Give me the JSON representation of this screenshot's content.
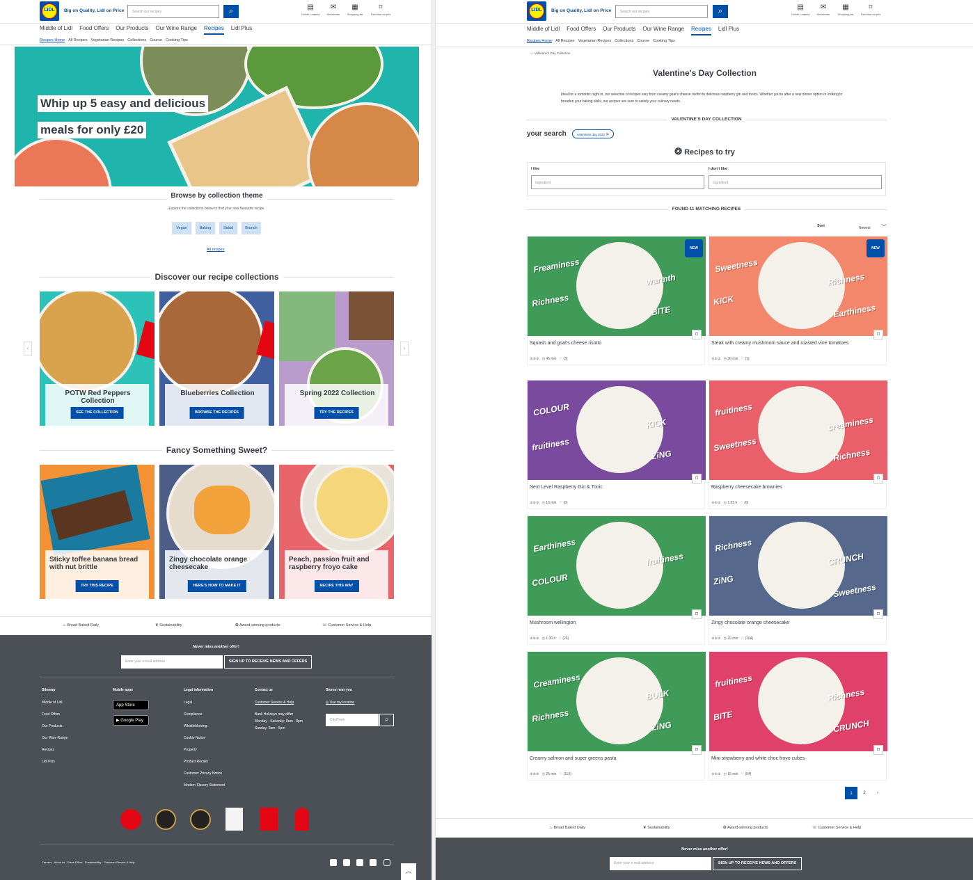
{
  "brand": {
    "logo": "LIDL",
    "tagline": "Big on Quality, Lidl on Price"
  },
  "header": {
    "search_placeholder": "Search our recipes",
    "icons": [
      {
        "label": "Online Leaflets",
        "icon": "leaflet-icon"
      },
      {
        "label": "Newsletter",
        "icon": "newsletter-icon"
      },
      {
        "label": "Shopping list",
        "icon": "shopping-list-icon"
      },
      {
        "label": "Favorite recipes",
        "icon": "bookmark-icon"
      }
    ]
  },
  "nav": {
    "main": [
      "Middle of Lidl",
      "Food Offers",
      "Our Products",
      "Our Wine Range",
      "Recipes",
      "Lidl Plus"
    ],
    "sub": [
      "Recipes Home",
      "All Recipes",
      "Vegetarian Recipes",
      "Collections",
      "Course",
      "Cooking Tips"
    ]
  },
  "left": {
    "hero": {
      "line1": "Whip up 5 easy and delicious",
      "line2": "meals for only £20"
    },
    "browse": {
      "title": "Browse by collection theme",
      "subtitle": "Explore the collections below to find your new favourite recipe.",
      "chips": [
        "Vegan",
        "Baking",
        "Salad",
        "Brunch"
      ],
      "all_link": "All recipes"
    },
    "discover": {
      "title": "Discover our recipe collections",
      "cards": [
        {
          "title": "POTW Red Peppers Collection",
          "button": "SEE THE COLLECTION"
        },
        {
          "title": "Blueberries Collection",
          "button": "BROWSE THE RECIPES"
        },
        {
          "title": "Spring 2022 Collection",
          "button": "TRY THE RECIPES"
        }
      ]
    },
    "sweet": {
      "title": "Fancy Something Sweet?",
      "cards": [
        {
          "title": "Sticky toffee banana bread with nut brittle",
          "button": "TRY THIS RECIPE"
        },
        {
          "title": "Zingy chocolate orange cheesecake",
          "button": "HERE'S HOW TO MAKE IT"
        },
        {
          "title": "Peach, passion fruit and raspberry froyo cake",
          "button": "RECIPE THIS WAY"
        }
      ]
    }
  },
  "features": [
    "Bread Baked Daily",
    "Sustainability",
    "Award-winning products",
    "Customer Service & Help"
  ],
  "footer": {
    "newsletter_title": "Never miss another offer!",
    "email_placeholder": "Enter your e-mail address",
    "signup_button": "SIGN UP TO RECEIVE NEWS AND OFFERS",
    "sitemap": {
      "heading": "Sitemap",
      "items": [
        "Middle of Lidl",
        "Food Offers",
        "Our Products",
        "Our Wine Range",
        "Recipes",
        "Lidl Plus"
      ]
    },
    "mobile": {
      "heading": "Mobile apps",
      "app_store": "App Store",
      "google_play": "Google Play"
    },
    "legal": {
      "heading": "Legal information",
      "items": [
        "Legal",
        "Compliance",
        "Whistleblowing",
        "Cookie Notice",
        "Property",
        "Product Recalls",
        "Customer Privacy Notice",
        "Modern Slavery Statement"
      ]
    },
    "contact": {
      "heading": "Contact us",
      "link": "Customer Service & Help",
      "lines": [
        "Bank Holidays may differ",
        "Monday - Saturday: 8am - 8pm",
        "Sunday: 9am - 5pm"
      ]
    },
    "stores": {
      "heading": "Stores near you",
      "link": "Use my location",
      "placeholder": "City/Town"
    },
    "bottom_links": [
      "Careers",
      "About us",
      "Press Office",
      "Sustainability",
      "Customer Service & Help"
    ]
  },
  "right": {
    "breadcrumb": "Valentine's Day Collection",
    "title": "Valentine's Day Collection",
    "intro": "Ideal for a romantic night in, our selection of recipes vary from creamy goat's cheese risotto to delicious raspberry gin and tonics. Whether you're after a new dinner option or looking to broaden your baking skills, our recipes are sure to satisfy your culinary needs.",
    "section": "VALENTINE'S DAY COLLECTION",
    "your_search": "your search",
    "search_tag": "valentines day 2022",
    "recipes_to_try": "Recipes to try",
    "like_label": "I like",
    "dislike_label": "I don't like",
    "ingredient_placeholder": "Ingredient",
    "found": "FOUND 11 MATCHING RECIPES",
    "sort_label": "Sort",
    "sort_value": "Newest",
    "new_badge": "NEW",
    "recipes": [
      {
        "name": "Squash and goat's cheese risotto",
        "time": "45 min",
        "likes": "(3)",
        "new": true,
        "bg": "#3f9b57",
        "words": [
          "Freaminess",
          "Richness",
          "warmth",
          "BITE"
        ]
      },
      {
        "name": "Steak with creamy mushroom sauce and roasted vine tomatoes",
        "time": "30 min",
        "likes": "(1)",
        "new": true,
        "bg": "#f3876b",
        "words": [
          "Sweetness",
          "KICK",
          "Richness",
          "Earthiness"
        ]
      },
      {
        "name": "Next Level Raspberry Gin & Tonic",
        "time": "10 min",
        "likes": "(0)",
        "new": false,
        "bg": "#7a4a9e",
        "words": [
          "COLOUR",
          "fruitiness",
          "KICK",
          "ZiNG"
        ]
      },
      {
        "name": "Raspberry cheesecake brownies",
        "time": "1:05 h",
        "likes": "(0)",
        "new": false,
        "bg": "#e9606a",
        "words": [
          "fruitiness",
          "Sweetness",
          "creaminess",
          "Richness"
        ]
      },
      {
        "name": "Mushroom wellington",
        "time": "1:30 h",
        "likes": "(26)",
        "new": false,
        "bg": "#3f9b57",
        "words": [
          "Earthiness",
          "COLOUR",
          "fruitiness"
        ]
      },
      {
        "name": "Zingy chocolate orange cheesecake",
        "time": "20 min",
        "likes": "(104)",
        "new": false,
        "bg": "#56698c",
        "words": [
          "Richness",
          "ZiNG",
          "CRUNCH",
          "Sweetness"
        ]
      },
      {
        "name": "Creamy salmon and super greens pasta",
        "time": "25 min",
        "likes": "(113)",
        "new": false,
        "bg": "#3f9b57",
        "words": [
          "Creaminess",
          "Richness",
          "BULK",
          "ZiNG"
        ]
      },
      {
        "name": "Mini strawberry and white choc froyo cubes",
        "time": "15 min",
        "likes": "(54)",
        "new": false,
        "bg": "#e0416a",
        "words": [
          "fruitiness",
          "BITE",
          "Richness",
          "CRUNCH"
        ]
      }
    ],
    "pages": [
      "1",
      "2"
    ]
  }
}
